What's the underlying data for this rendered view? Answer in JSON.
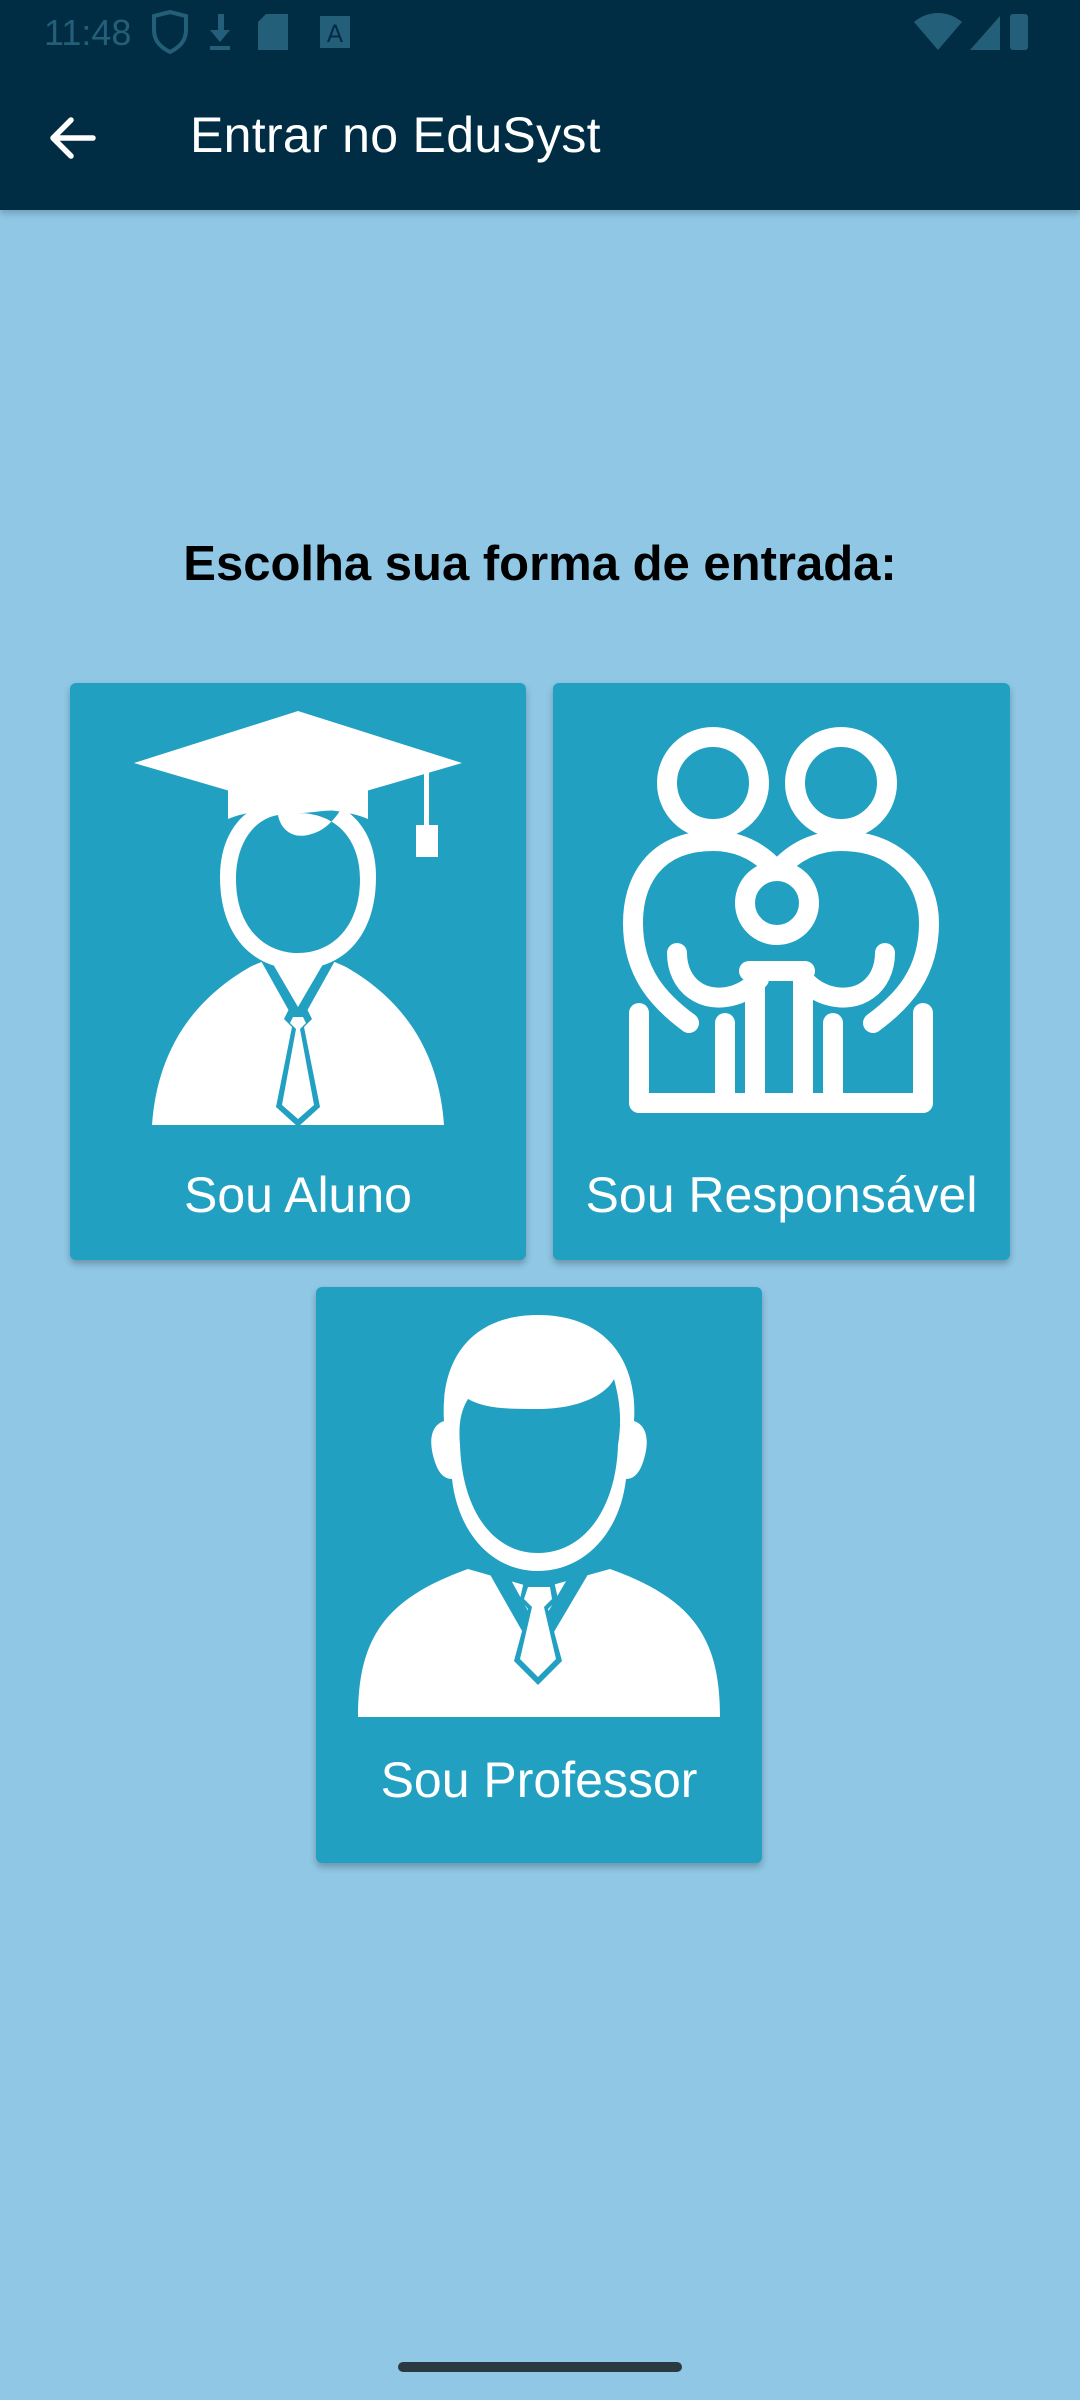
{
  "status_bar": {
    "time": "11:48",
    "left_icons": [
      "shield-icon",
      "download-icon",
      "sd-card-icon",
      "a-badge-icon"
    ],
    "right_icons": [
      "wifi-icon",
      "signal-icon",
      "battery-icon"
    ]
  },
  "app_bar": {
    "back_icon": "arrow-left-icon",
    "title": "Entrar no EduSyst"
  },
  "main": {
    "prompt": "Escolha sua forma de entrada:",
    "options": [
      {
        "label": "Sou Aluno",
        "icon": "graduate-student-icon"
      },
      {
        "label": "Sou Responsável",
        "icon": "family-icon"
      },
      {
        "label": "Sou Professor",
        "icon": "teacher-icon"
      }
    ]
  },
  "colors": {
    "app_bar_bg": "#002d44",
    "page_bg": "#8fc7e5",
    "card_bg": "#21a0c1",
    "card_text": "#ffffff"
  }
}
